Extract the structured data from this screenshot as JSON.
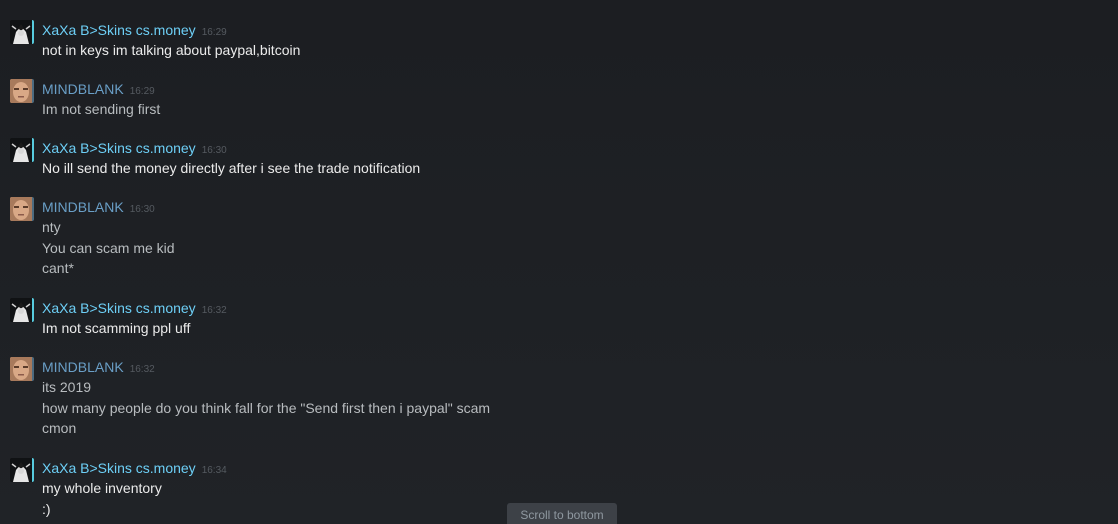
{
  "chat": {
    "messages": [
      {
        "sender": "XaXa B>Skins cs.money",
        "time": "16:29",
        "lines": [
          "not in keys im talking about paypal,bitcoin"
        ]
      },
      {
        "sender": "MINDBLANK",
        "time": "16:29",
        "lines": [
          "Im not sending first"
        ]
      },
      {
        "sender": "XaXa B>Skins cs.money",
        "time": "16:30",
        "lines": [
          "No ill send the money directly after i see the trade notification"
        ]
      },
      {
        "sender": "MINDBLANK",
        "time": "16:30",
        "lines": [
          "nty",
          "You can scam me kid",
          "cant*"
        ]
      },
      {
        "sender": "XaXa B>Skins cs.money",
        "time": "16:32",
        "lines": [
          "Im not scamming ppl uff"
        ]
      },
      {
        "sender": "MINDBLANK",
        "time": "16:32",
        "lines": [
          "its 2019",
          "how many people do you think fall for the \"Send first then i paypal\" scam",
          "cmon"
        ]
      },
      {
        "sender": "XaXa B>Skins cs.money",
        "time": "16:34",
        "lines": [
          "my whole inventory",
          ":)"
        ]
      }
    ]
  },
  "scroll_to_bottom": {
    "label": "Scroll to bottom"
  },
  "colors": {
    "background": "#1e2024",
    "xaxa_name": "#6dcff6",
    "mindblank_name": "#6a9fc7",
    "xaxa_text": "#ebebeb",
    "mindblank_text": "#b8bcbf",
    "timestamp": "#555a60"
  },
  "icons": {
    "xaxa_avatar": "anime-character-avatar",
    "mindblank_avatar": "face-photo-avatar"
  }
}
